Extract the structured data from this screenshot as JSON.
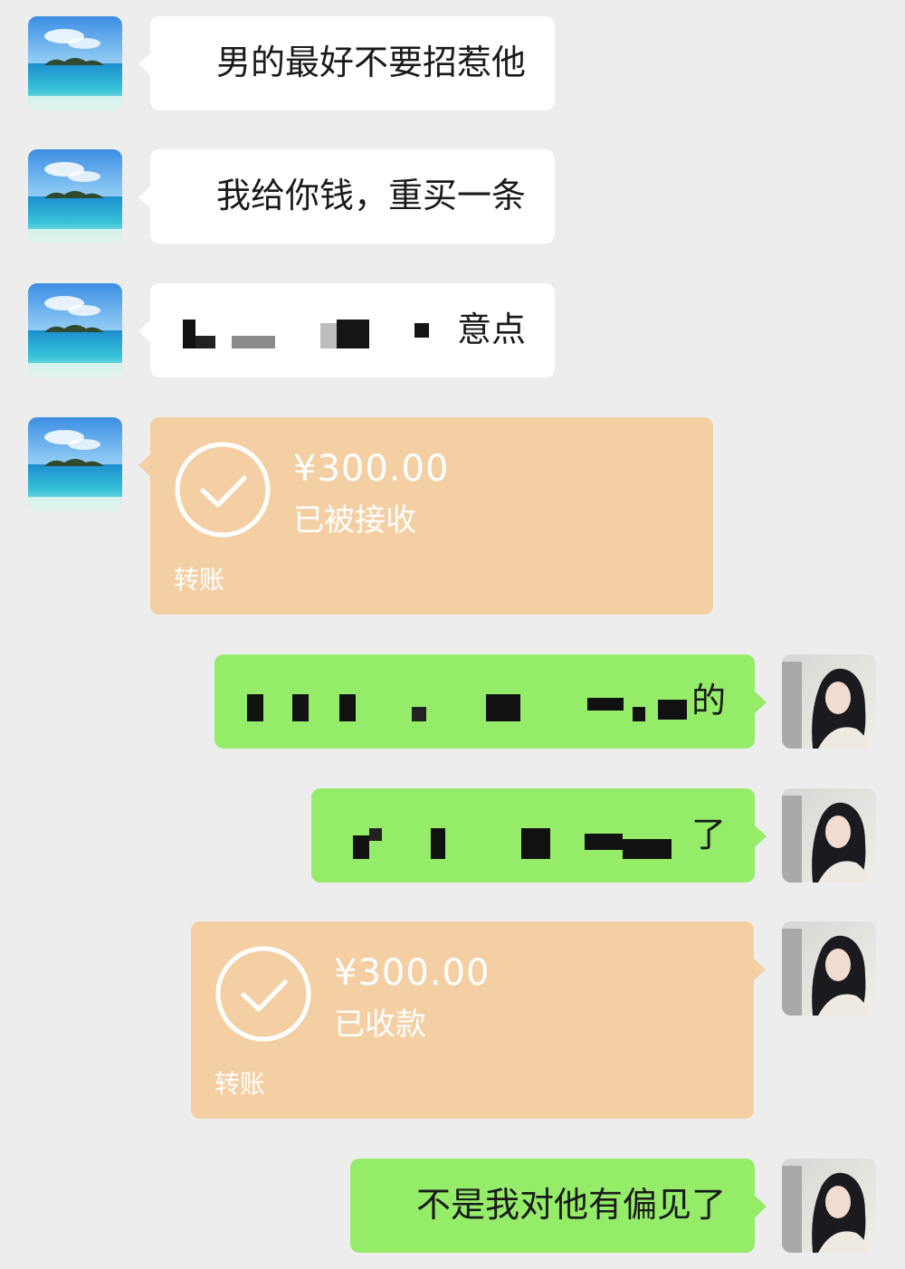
{
  "messages": {
    "m1": "男的最好不要招惹他",
    "m2": "我给你钱，重买一条",
    "m3_visible": "意点",
    "transfer1": {
      "amount": "¥300.00",
      "status": "已被接收",
      "label": "转账"
    },
    "m5_visible": "的",
    "m6_visible": "了",
    "transfer2": {
      "amount": "¥300.00",
      "status": "已收款",
      "label": "转账"
    },
    "m8": "不是我对他有偏见了"
  },
  "colors": {
    "background": "#ededed",
    "bubble_in": "#ffffff",
    "bubble_out": "#95ec69",
    "transfer": "#f4cfa3"
  },
  "icons": {
    "avatar_left": "beach-island-avatar",
    "avatar_right": "girl-portrait-avatar",
    "transfer_status": "check-circle-icon"
  }
}
